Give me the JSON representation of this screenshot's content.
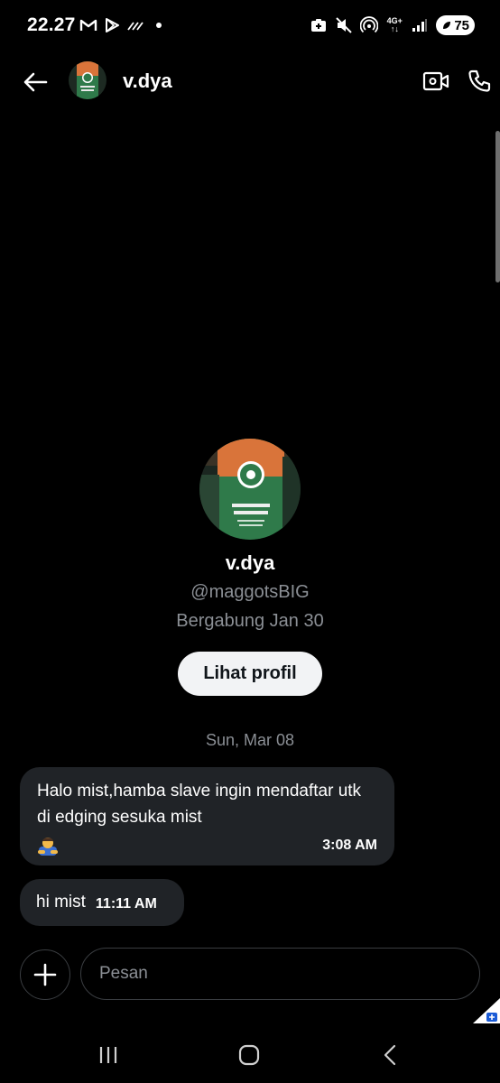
{
  "status_bar": {
    "time": "22.27",
    "left_icons": [
      "gmail-icon",
      "play-icon",
      "stripes-icon",
      "dot-icon"
    ],
    "right_icons": [
      "notification-box-icon",
      "mute-icon",
      "hotspot-icon",
      "network-4g-icon",
      "signal-icon"
    ],
    "network_top": "4G+",
    "network_bottom": "↑↓",
    "battery": "75"
  },
  "header": {
    "back_icon": "arrow-left-icon",
    "title": "v.dya",
    "video_icon": "video-call-icon",
    "call_icon": "phone-call-icon"
  },
  "profile": {
    "name": "v.dya",
    "handle": "@maggotsBIG",
    "joined": "Bergabung Jan 30",
    "view_button": "Lihat profil"
  },
  "conversation": {
    "date": "Sun, Mar 08",
    "messages": [
      {
        "text": "Halo mist,hamba slave ingin mendaftar utk di edging sesuka mist",
        "emoji_icon": "person-bowing-emoji-icon",
        "time": "3:08 AM"
      },
      {
        "text": "hi mist",
        "time": "11:11 AM"
      }
    ]
  },
  "composer": {
    "add_icon": "plus-icon",
    "placeholder": "Pesan",
    "value": ""
  },
  "nav_bar": {
    "icons": [
      "recent-apps-icon",
      "home-icon",
      "back-icon"
    ]
  },
  "colors": {
    "background": "#000000",
    "bubble": "#202327",
    "muted_text": "#8b8f95",
    "button_bg": "#f2f3f5",
    "avatar_orange": "#d9743a",
    "avatar_green": "#2f7a4a"
  }
}
